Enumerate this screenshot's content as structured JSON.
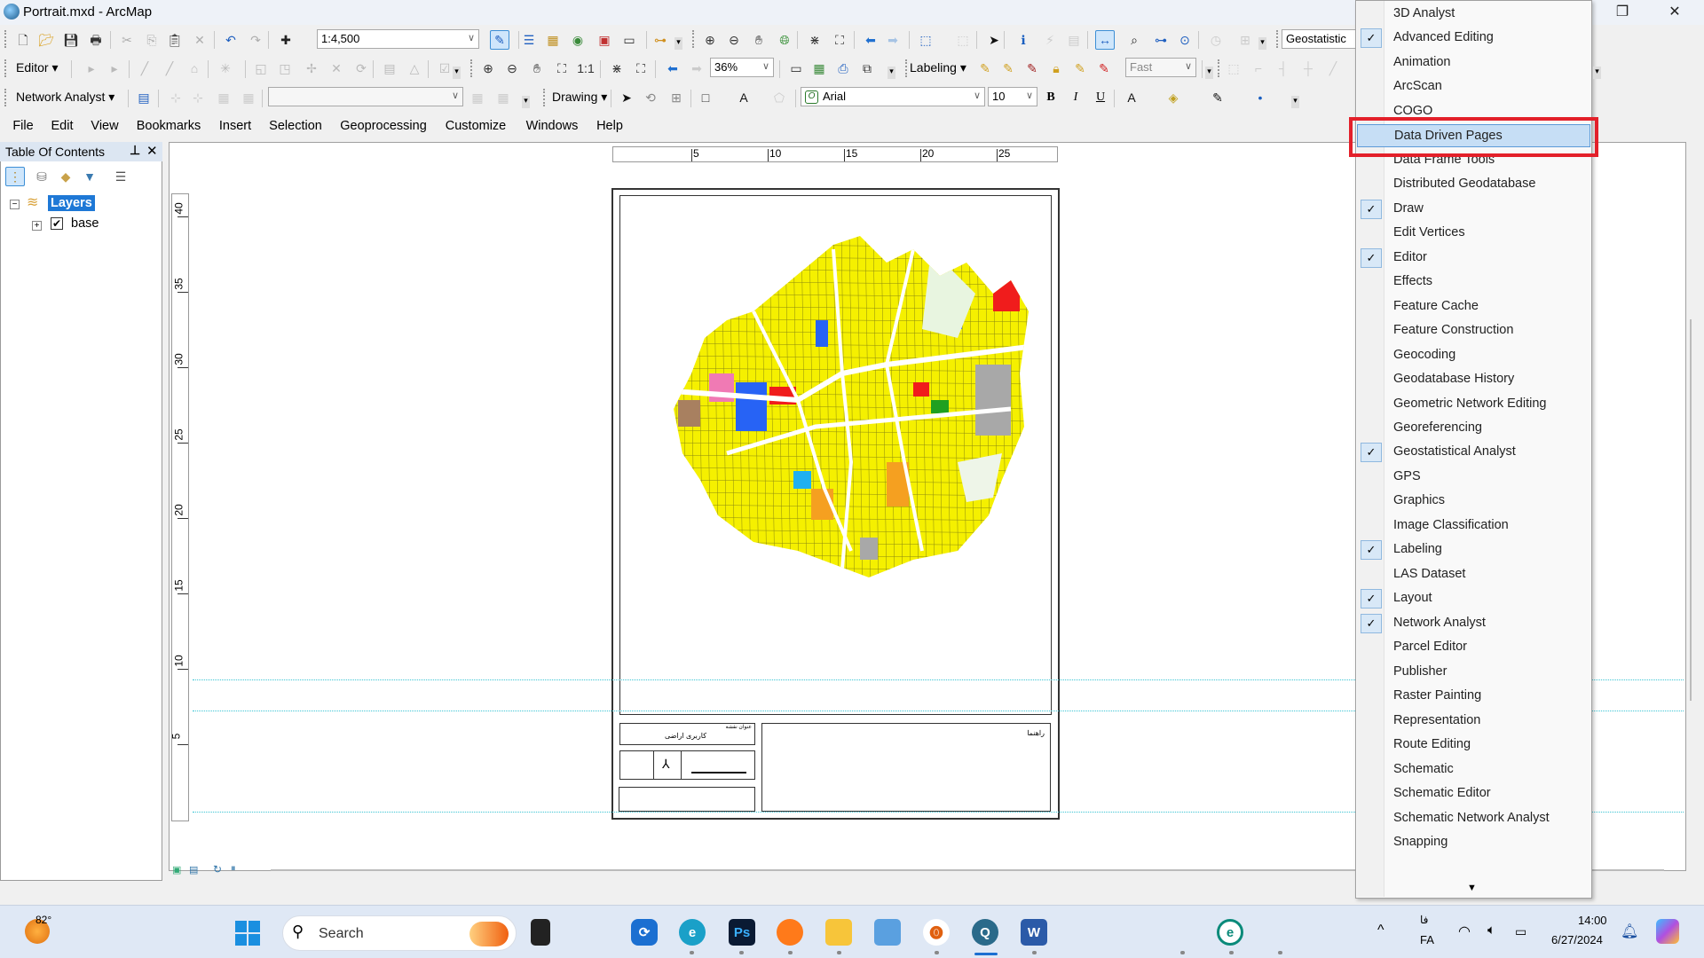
{
  "window": {
    "title": "Portrait.mxd - ArcMap",
    "restore_icon": "restore-icon",
    "close_icon": "close-icon"
  },
  "toolbar": {
    "scale": "1:4,500",
    "editor_label": "Editor",
    "zoom_percent": "36%",
    "labeling_label": "Labeling",
    "label_quality": "Fast",
    "network_analyst_label": "Network Analyst",
    "drawing_label": "Drawing",
    "font": "Arial",
    "font_size": "10",
    "geostatistical_label": "Geostatistic",
    "bold": "B",
    "italic": "I",
    "underline": "U"
  },
  "menubar": [
    "File",
    "Edit",
    "View",
    "Bookmarks",
    "Insert",
    "Selection",
    "Geoprocessing",
    "Customize",
    "Windows",
    "Help"
  ],
  "toc": {
    "title": "Table Of Contents",
    "root": "Layers",
    "layers": [
      {
        "name": "base",
        "checked": true
      }
    ]
  },
  "rulers": {
    "top": [
      "5",
      "10",
      "15",
      "20",
      "25"
    ],
    "left": [
      "40",
      "35",
      "30",
      "25",
      "20",
      "15",
      "10",
      "5"
    ]
  },
  "layout": {
    "title_header": "عنوان نقشه",
    "map_title": "کاربری اراضی",
    "legend_title": "راهنما"
  },
  "customize_menu": {
    "items": [
      {
        "label": "3D Analyst",
        "checked": false
      },
      {
        "label": "Advanced Editing",
        "checked": true
      },
      {
        "label": "Animation",
        "checked": false
      },
      {
        "label": "ArcScan",
        "checked": false
      },
      {
        "label": "COGO",
        "checked": false
      },
      {
        "label": "Data Driven Pages",
        "checked": false,
        "highlighted": true
      },
      {
        "label": "Data Frame Tools",
        "checked": false
      },
      {
        "label": "Distributed Geodatabase",
        "checked": false
      },
      {
        "label": "Draw",
        "checked": true
      },
      {
        "label": "Edit Vertices",
        "checked": false
      },
      {
        "label": "Editor",
        "checked": true
      },
      {
        "label": "Effects",
        "checked": false
      },
      {
        "label": "Feature Cache",
        "checked": false
      },
      {
        "label": "Feature Construction",
        "checked": false
      },
      {
        "label": "Geocoding",
        "checked": false
      },
      {
        "label": "Geodatabase History",
        "checked": false
      },
      {
        "label": "Geometric Network Editing",
        "checked": false
      },
      {
        "label": "Georeferencing",
        "checked": false
      },
      {
        "label": "Geostatistical Analyst",
        "checked": true
      },
      {
        "label": "GPS",
        "checked": false
      },
      {
        "label": "Graphics",
        "checked": false
      },
      {
        "label": "Image Classification",
        "checked": false
      },
      {
        "label": "Labeling",
        "checked": true
      },
      {
        "label": "LAS Dataset",
        "checked": false
      },
      {
        "label": "Layout",
        "checked": true
      },
      {
        "label": "Network Analyst",
        "checked": true
      },
      {
        "label": "Parcel Editor",
        "checked": false
      },
      {
        "label": "Publisher",
        "checked": false
      },
      {
        "label": "Raster Painting",
        "checked": false
      },
      {
        "label": "Representation",
        "checked": false
      },
      {
        "label": "Route Editing",
        "checked": false
      },
      {
        "label": "Schematic",
        "checked": false
      },
      {
        "label": "Schematic Editor",
        "checked": false
      },
      {
        "label": "Schematic Network Analyst",
        "checked": false
      },
      {
        "label": "Snapping",
        "checked": false
      }
    ],
    "highlight_color": "#e3202a"
  },
  "taskbar": {
    "weather": "82°",
    "search_placeholder": "Search",
    "language_top": "فا",
    "language": "FA",
    "time": "14:00",
    "date": "6/27/2024"
  }
}
